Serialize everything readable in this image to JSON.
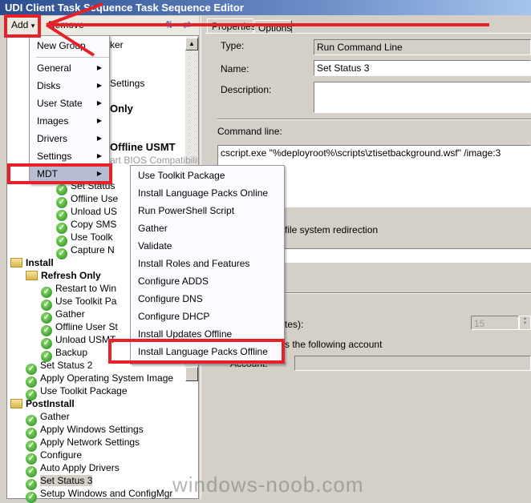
{
  "window": {
    "title": "UDI Client Task Sequence Task Sequence Editor"
  },
  "toolbar": {
    "add": "Add",
    "add_arrow": "▾",
    "remove": "Remove"
  },
  "tabs": [
    "Properties",
    "Options"
  ],
  "tree_hidden_fragments": [
    "ker",
    "Settings",
    "Only",
    "Offline USMT",
    "art BIOS Compatibilit"
  ],
  "tree": [
    {
      "label": "Set Status",
      "level": 3,
      "type": "step"
    },
    {
      "label": "Offline Use",
      "level": 3,
      "type": "step"
    },
    {
      "label": "Unload US",
      "level": 3,
      "type": "step"
    },
    {
      "label": "Copy SMS",
      "level": 3,
      "type": "step"
    },
    {
      "label": "Use Toolk",
      "level": 3,
      "type": "step"
    },
    {
      "label": "Capture N",
      "level": 3,
      "type": "step"
    },
    {
      "label": "Install",
      "level": 0,
      "type": "group"
    },
    {
      "label": "Refresh Only",
      "level": 1,
      "type": "group"
    },
    {
      "label": "Restart to Win",
      "level": 2,
      "type": "step"
    },
    {
      "label": "Use Toolkit Pa",
      "level": 2,
      "type": "step"
    },
    {
      "label": "Gather",
      "level": 2,
      "type": "step"
    },
    {
      "label": "Offline User St",
      "level": 2,
      "type": "step"
    },
    {
      "label": "Unload USMT",
      "level": 2,
      "type": "step"
    },
    {
      "label": "Backup",
      "level": 2,
      "type": "step"
    },
    {
      "label": "Set Status 2",
      "level": 1,
      "type": "step"
    },
    {
      "label": "Apply Operating System Image",
      "level": 1,
      "type": "step"
    },
    {
      "label": "Use Toolkit Package",
      "level": 1,
      "type": "step"
    },
    {
      "label": "PostInstall",
      "level": 0,
      "type": "group"
    },
    {
      "label": "Gather",
      "level": 1,
      "type": "step"
    },
    {
      "label": "Apply Windows Settings",
      "level": 1,
      "type": "step"
    },
    {
      "label": "Apply Network Settings",
      "level": 1,
      "type": "step"
    },
    {
      "label": "Configure",
      "level": 1,
      "type": "step"
    },
    {
      "label": "Auto Apply Drivers",
      "level": 1,
      "type": "step"
    },
    {
      "label": "Set Status 3",
      "level": 1,
      "type": "step",
      "selected": true
    },
    {
      "label": "Setup Windows and ConfigMgr",
      "level": 1,
      "type": "step"
    }
  ],
  "add_menu": {
    "new_group": "New Group",
    "items": [
      "General",
      "Disks",
      "User State",
      "Images",
      "Drivers",
      "Settings",
      "MDT"
    ],
    "highlighted": "MDT"
  },
  "mdt_submenu": [
    "Use Toolkit Package",
    "Install Language Packs Online",
    "Run PowerShell Script",
    "Gather",
    "Validate",
    "Install Roles and Features",
    "Configure ADDS",
    "Configure DNS",
    "Configure DHCP",
    "Install Updates Offline",
    "Install Language Packs Offline"
  ],
  "properties": {
    "type_label": "Type:",
    "type_value": "Run Command Line",
    "name_label": "Name:",
    "name_value": "Set Status 3",
    "description_label": "Description:",
    "description_value": "",
    "command_label": "Command line:",
    "command_value": "cscript.exe \"%deployroot%\\scripts\\ztisetbackground.wsf\" /image:3",
    "redirection_fragment": "file system redirection",
    "timeout_fragment": "tes):",
    "timeout_value": "15",
    "account_fragment": "s the following account",
    "account_label": "Account:",
    "account_value": ""
  },
  "watermark": "windows-noob.com",
  "colors": {
    "annotation": "#e8202a",
    "highlight": "#b6bdd2",
    "title_bar": "#2b4d8f"
  }
}
